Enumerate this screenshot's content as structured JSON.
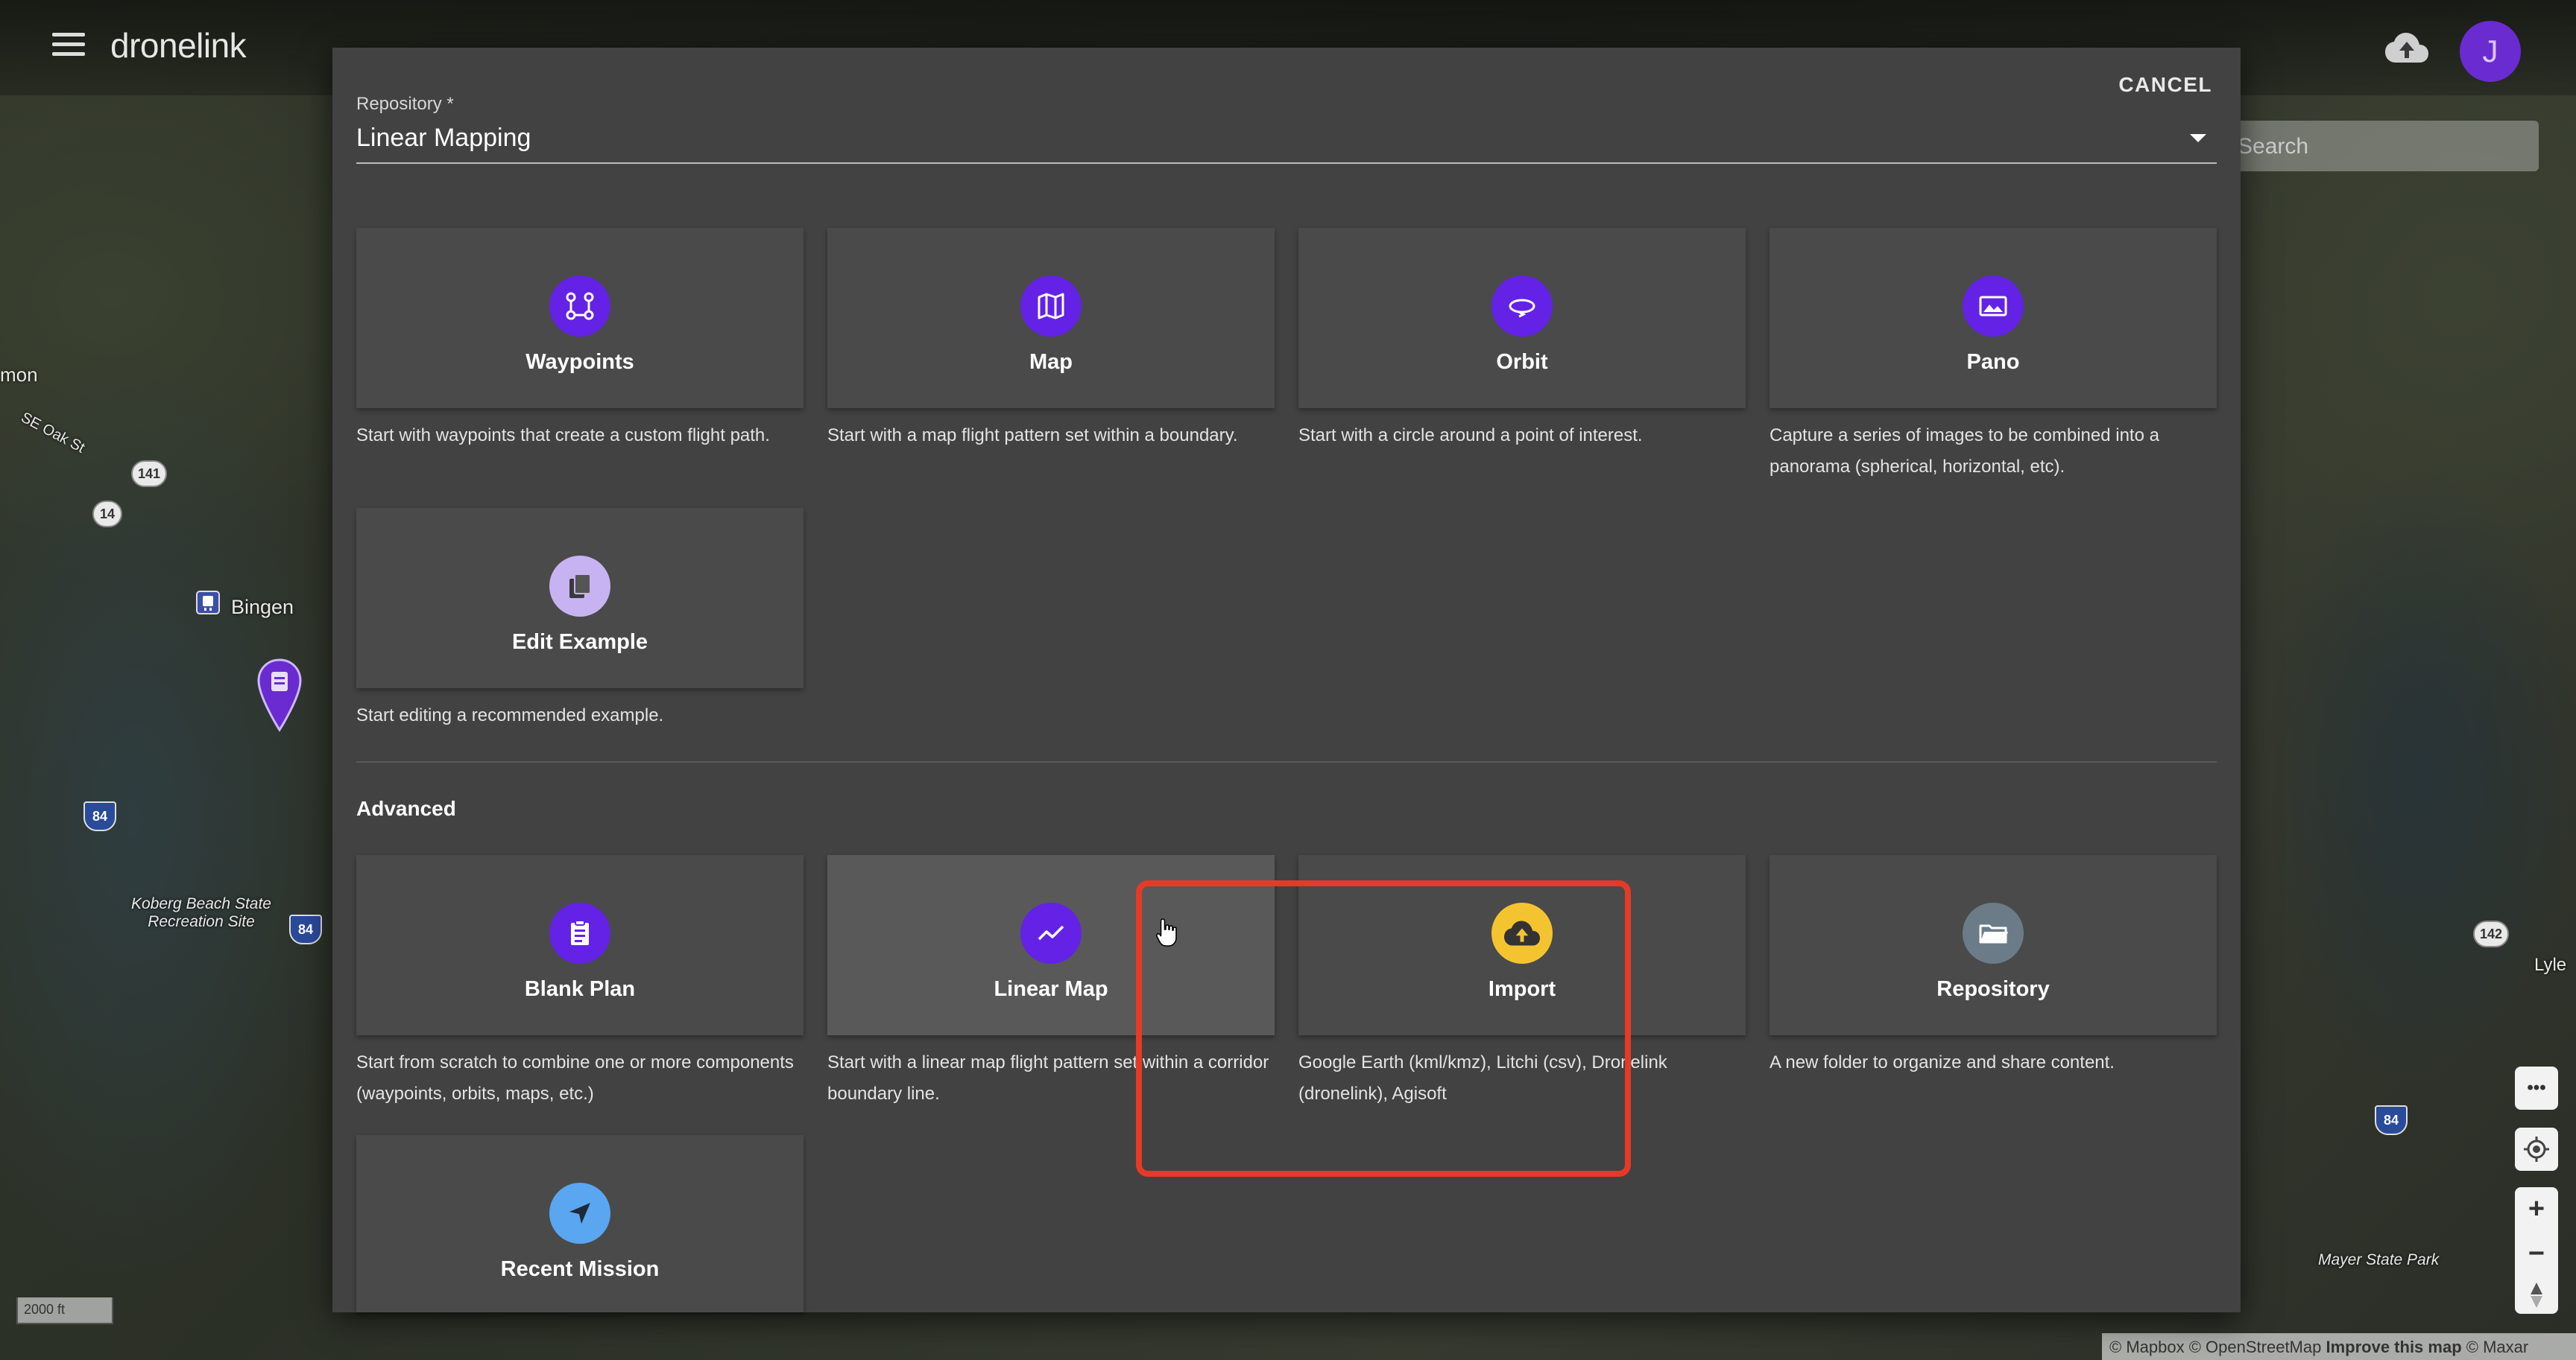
{
  "app": {
    "brand": "dronelink",
    "avatar_initial": "J"
  },
  "map": {
    "search_placeholder": "Search",
    "labels": {
      "mon": "mon",
      "oak_st": "SE Oak St",
      "bingen": "Bingen",
      "koberg": "Koberg Beach State Recreation Site",
      "lyle": "Lyle",
      "mayer": "Mayer State Park"
    },
    "shields": {
      "s141": "141",
      "s14": "14",
      "i84a": "84",
      "i84b": "84",
      "i84c": "84",
      "s142": "142"
    },
    "scale": "2000 ft",
    "attribution": {
      "mapbox": "© Mapbox",
      "osm": "© OpenStreetMap",
      "improve": "Improve this map",
      "maxar": "© Maxar"
    },
    "controls": {
      "more": "•••",
      "zoom_in": "+",
      "zoom_out": "−"
    }
  },
  "dialog": {
    "cancel_label": "CANCEL",
    "repository_label": "Repository *",
    "repository_value": "Linear Mapping",
    "templates": [
      {
        "title": "Waypoints",
        "icon": "waypoints-icon",
        "description": "Start with waypoints that create a custom flight path."
      },
      {
        "title": "Map",
        "icon": "map-icon",
        "description": "Start with a map flight pattern set within a boundary."
      },
      {
        "title": "Orbit",
        "icon": "orbit-icon",
        "description": "Start with a circle around a point of interest."
      },
      {
        "title": "Pano",
        "icon": "pano-icon",
        "description": "Capture a series of images to be combined into a panorama (spherical, horizontal, etc)."
      },
      {
        "title": "Edit Example",
        "icon": "copy-icon",
        "description": "Start editing a recommended example."
      }
    ],
    "advanced_title": "Advanced",
    "advanced": [
      {
        "title": "Blank Plan",
        "icon": "clipboard-icon",
        "description": "Start from scratch to combine one or more components (waypoints, orbits, maps, etc.)"
      },
      {
        "title": "Linear Map",
        "icon": "trending-line-icon",
        "description": "Start with a linear map flight pattern set within a corridor boundary line."
      },
      {
        "title": "Import",
        "icon": "cloud-upload-icon",
        "description": "Google Earth (kml/kmz), Litchi (csv), Dronelink (dronelink), Agisoft"
      },
      {
        "title": "Repository",
        "icon": "folder-icon",
        "description": "A new folder to organize and share content."
      },
      {
        "title": "Recent Mission",
        "icon": "navigation-arrow-icon",
        "description": ""
      }
    ]
  },
  "colors": {
    "accent_purple": "#6322e6",
    "edit_example_lavender": "#c7b3f2",
    "import_yellow": "#f4c430",
    "repository_gray": "#6b7c88",
    "recent_blue": "#5aa6f0",
    "highlight_red": "#e53a27"
  }
}
